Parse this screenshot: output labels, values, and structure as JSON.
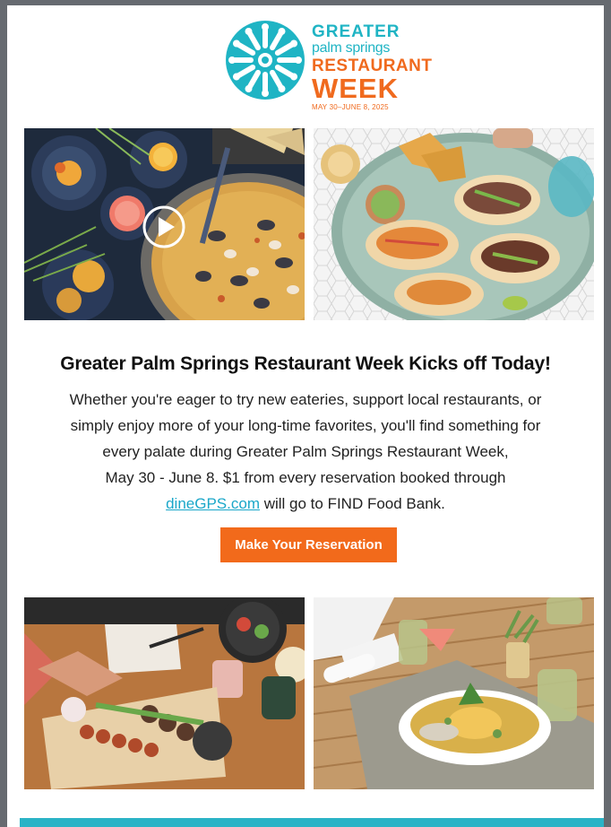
{
  "logo": {
    "line1": "GREATER",
    "line2": "palm springs",
    "line3": "RESTAURANT",
    "line4": "WEEK",
    "dates": "MAY 30–JUNE 8, 2025",
    "colors": {
      "teal": "#1fb4c4",
      "orange": "#f06a1e"
    }
  },
  "images": {
    "top_left": {
      "subject": "paella-spread",
      "overlay": "play-icon"
    },
    "top_right": {
      "subject": "tacos-platter"
    },
    "bottom_left": {
      "subject": "kebab-platter"
    },
    "bottom_right": {
      "subject": "plated-fish-dinner"
    }
  },
  "headline": "Greater Palm Springs Restaurant Week Kicks off Today!",
  "body": {
    "line1": "Whether you're eager to try new eateries, support local restaurants, or",
    "line2": "simply enjoy more of your long-time favorites, you'll find something for",
    "line3": "every palate during Greater Palm Springs Restaurant Week,",
    "line4": "May 30 - June 8. $1 from every reservation booked through",
    "link_text": "dineGPS.com",
    "line5_rest": " will go to FIND Food Bank."
  },
  "cta": {
    "label": "Make Your Reservation",
    "color": "#f26a1b"
  },
  "footer_bar_color": "#2bb3c6"
}
